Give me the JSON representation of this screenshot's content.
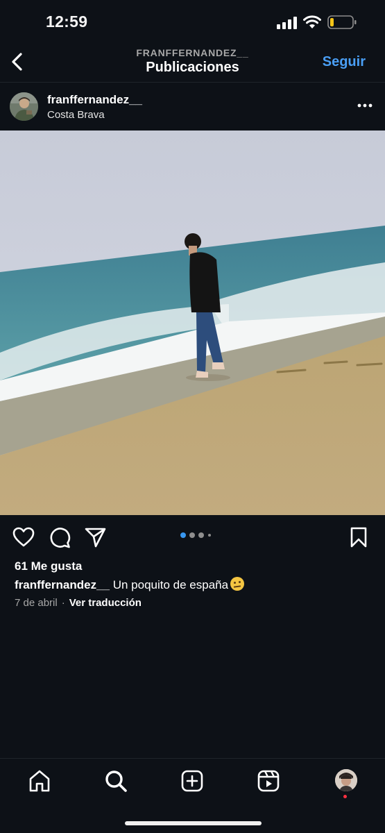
{
  "status": {
    "time": "12:59"
  },
  "header": {
    "username": "FRANFFERNANDEZ__",
    "title": "Publicaciones",
    "follow_label": "Seguir"
  },
  "post": {
    "username": "franffernandez__",
    "location": "Costa Brava",
    "likes": "61 Me gusta",
    "caption_user": "franffernandez__",
    "caption_text": "Un poquito de españa",
    "date": "7 de abril",
    "separator": "·",
    "translate_label": "Ver traducción",
    "carousel": {
      "count": 4,
      "current": 1
    }
  },
  "icons": {
    "back": "chevron-left-icon",
    "more": "more-horizontal-icon",
    "like": "heart-icon",
    "comment": "comment-icon",
    "share": "send-icon",
    "save": "bookmark-icon",
    "home": "home-icon",
    "search": "search-icon",
    "create": "plus-square-icon",
    "reels": "reels-icon"
  },
  "colors": {
    "background": "#0d1117",
    "accent": "#4a9ff5",
    "notification": "#ff3040"
  }
}
